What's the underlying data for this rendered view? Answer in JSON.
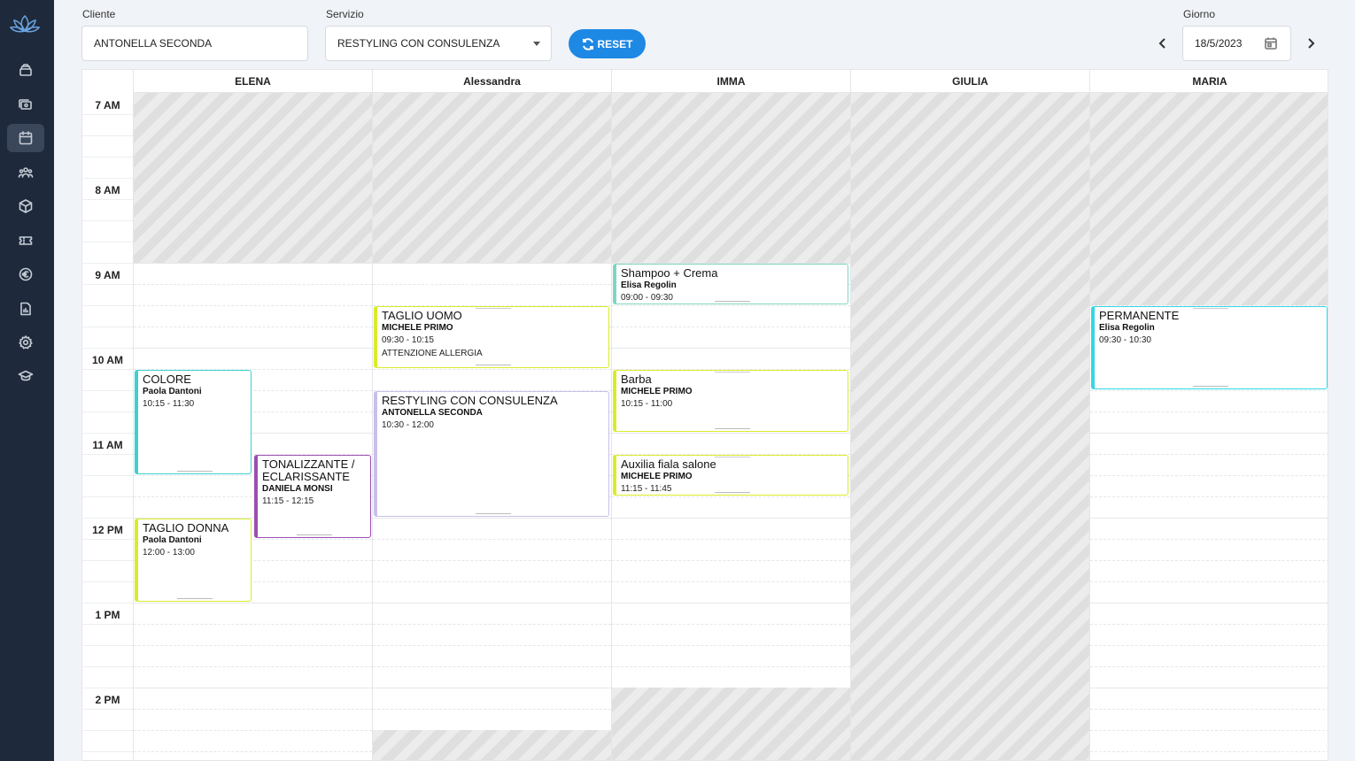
{
  "filters": {
    "cliente_label": "Cliente",
    "cliente_value": "ANTONELLA SECONDA",
    "servizio_label": "Servizio",
    "servizio_value": "RESTYLING CON CONSULENZA",
    "reset_label": "RESET",
    "giorno_label": "Giorno",
    "giorno_value": "18/5/2023"
  },
  "sidebar": {
    "logo": "lotus-logo",
    "items": [
      {
        "icon": "stack-icon"
      },
      {
        "icon": "cards-icon"
      },
      {
        "icon": "calendar-icon",
        "active": true
      },
      {
        "icon": "users-icon"
      },
      {
        "icon": "box-icon"
      },
      {
        "icon": "ticket-icon"
      },
      {
        "icon": "euro-icon"
      },
      {
        "icon": "report-icon"
      },
      {
        "icon": "gear-icon"
      },
      {
        "icon": "graduation-icon"
      }
    ]
  },
  "calendar": {
    "time_labels": [
      "7 AM",
      "8 AM",
      "9 AM",
      "10 AM",
      "11 AM",
      "12 PM",
      "1 PM",
      "2 PM"
    ],
    "columns": [
      {
        "name": "ELENA"
      },
      {
        "name": "Alessandra"
      },
      {
        "name": "IMMA"
      },
      {
        "name": "GIULIA"
      },
      {
        "name": "MARIA"
      }
    ],
    "events": [
      {
        "title": "COLORE",
        "client": "Paola Dantoni",
        "time": "10:15 - 11:30",
        "note": "",
        "color": "#3ecfcf"
      },
      {
        "title": "TONALIZZANTE / ECLARISSANTE",
        "client": "DANIELA MONSI",
        "time": "11:15 - 12:15",
        "note": "",
        "color": "#9b4fb0"
      },
      {
        "title": "TAGLIO DONNA",
        "client": "Paola Dantoni",
        "time": "12:00 - 13:00",
        "note": "",
        "color": "#d9ec2a"
      },
      {
        "title": "TAGLIO UOMO",
        "client": "MICHELE PRIMO",
        "time": "09:30 - 10:15",
        "note": "ATTENZIONE ALLERGIA",
        "color": "#d9ec2a"
      },
      {
        "title": "RESTYLING CON CONSULENZA",
        "client": "ANTONELLA SECONDA",
        "time": "10:30 - 12:00",
        "note": "",
        "color": "#c9c0ea"
      },
      {
        "title": "Shampoo + Crema",
        "client": "Elisa Regolin",
        "time": "09:00 - 09:30",
        "note": "",
        "color": "#7fd6c0"
      },
      {
        "title": "Barba",
        "client": "MICHELE PRIMO",
        "time": "10:15 - 11:00",
        "note": "",
        "color": "#d9ec2a"
      },
      {
        "title": "Auxilia fiala salone",
        "client": "MICHELE PRIMO",
        "time": "11:15 - 11:45",
        "note": "",
        "color": "#d9ec2a"
      },
      {
        "title": "PERMANENTE",
        "client": "Elisa Regolin",
        "time": "09:30 - 10:30",
        "note": "",
        "color": "#34d6e6"
      }
    ]
  }
}
